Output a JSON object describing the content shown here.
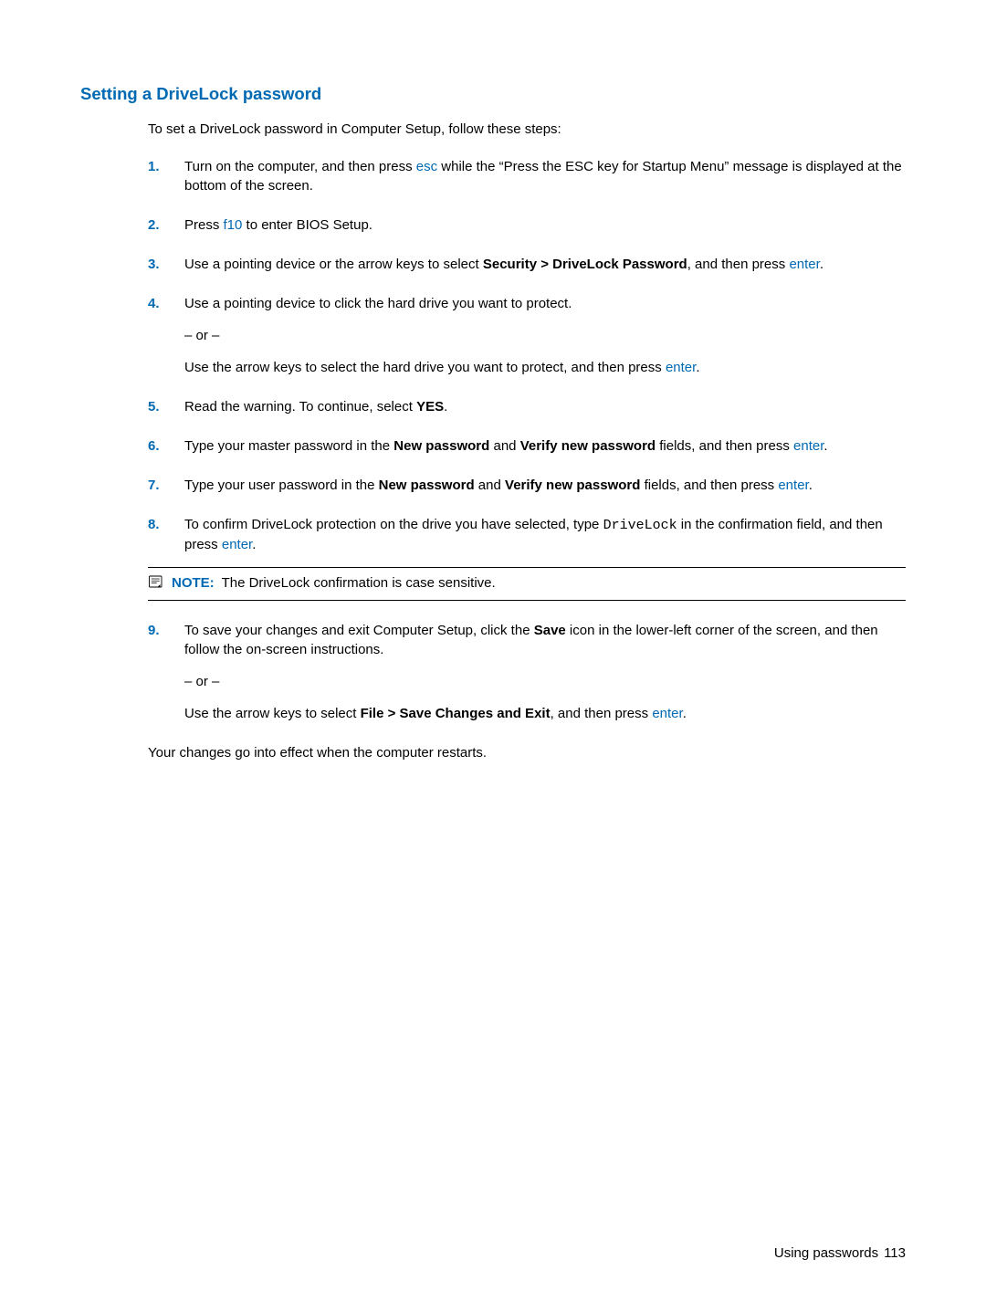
{
  "heading": "Setting a DriveLock password",
  "intro": "To set a DriveLock password in Computer Setup, follow these steps:",
  "steps": {
    "s1": {
      "num": "1.",
      "a": "Turn on the computer, and then press ",
      "key": "esc",
      "b": " while the “Press the ESC key for Startup Menu” message is displayed at the bottom of the screen."
    },
    "s2": {
      "num": "2.",
      "a": "Press ",
      "key": "f10",
      "b": " to enter BIOS Setup."
    },
    "s3": {
      "num": "3.",
      "a": "Use a pointing device or the arrow keys to select ",
      "bold": "Security > DriveLock Password",
      "b": ", and then press ",
      "key": "enter",
      "c": "."
    },
    "s4": {
      "num": "4.",
      "a": "Use a pointing device to click the hard drive you want to protect.",
      "or": "– or –",
      "b1": "Use the arrow keys to select the hard drive you want to protect, and then press ",
      "key": "enter",
      "b2": "."
    },
    "s5": {
      "num": "5.",
      "a": "Read the warning. To continue, select ",
      "bold": "YES",
      "b": "."
    },
    "s6": {
      "num": "6.",
      "a": "Type your master password in the ",
      "bold1": "New password",
      "b": " and ",
      "bold2": "Verify new password",
      "c": " fields, and then press ",
      "key": "enter",
      "d": "."
    },
    "s7": {
      "num": "7.",
      "a": "Type your user password in the ",
      "bold1": "New password",
      "b": " and ",
      "bold2": "Verify new password",
      "c": " fields, and then press ",
      "key": "enter",
      "d": "."
    },
    "s8": {
      "num": "8.",
      "a": "To confirm DriveLock protection on the drive you have selected, type ",
      "mono": "DriveLock",
      "b": " in the confirmation field, and then press ",
      "key": "enter",
      "c": ".",
      "note_label": "NOTE:",
      "note_text": "The DriveLock confirmation is case sensitive."
    },
    "s9": {
      "num": "9.",
      "a": "To save your changes and exit Computer Setup, click the ",
      "bold1": "Save",
      "b": " icon in the lower-left corner of the screen, and then follow the on-screen instructions.",
      "or": "– or –",
      "c1": "Use the arrow keys to select ",
      "bold2": "File > Save Changes and Exit",
      "c2": ", and then press ",
      "key": "enter",
      "c3": "."
    }
  },
  "closing": "Your changes go into effect when the computer restarts.",
  "footer": {
    "section": "Using passwords",
    "page": "113"
  }
}
